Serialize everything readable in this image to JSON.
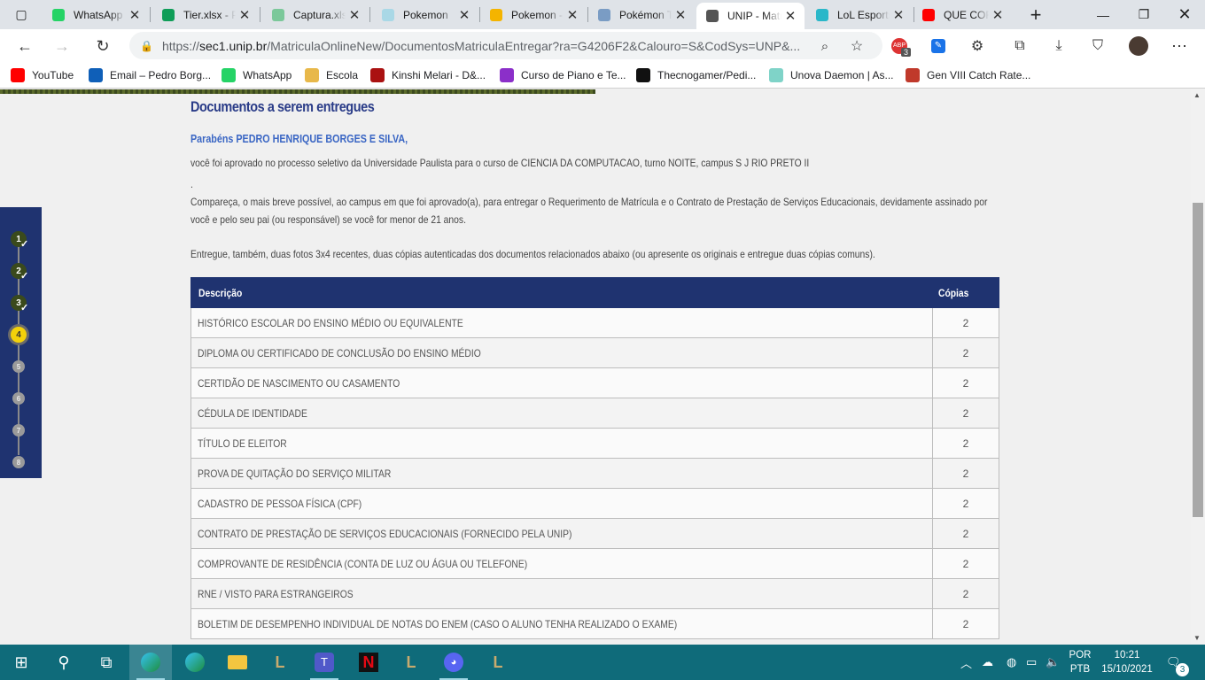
{
  "browser": {
    "tabs": [
      {
        "label": "WhatsApp",
        "icon": "whatsapp-icon",
        "color": "#25d366"
      },
      {
        "label": "Tier.xlsx - Planilhas Google",
        "icon": "sheets-icon",
        "color": "#0f9d58"
      },
      {
        "label": "Captura.xlsx - Planilhas Google",
        "icon": "sheets-icon",
        "color": "#7bc89a"
      },
      {
        "label": "Pokemon",
        "icon": "diamond-icon",
        "color": "#a9d8e6"
      },
      {
        "label": "Pokemon - Google Drive",
        "icon": "drive-icon",
        "color": "#f4b400"
      },
      {
        "label": "Pokémon Tier",
        "icon": "drop-icon",
        "color": "#7a9cc4"
      },
      {
        "label": "UNIP - Matrícula",
        "icon": "page-icon",
        "color": "#555555"
      },
      {
        "label": "LoL Esports",
        "icon": "lol-esports-icon",
        "color": "#2ab7c9"
      },
      {
        "label": "QUE COR É",
        "icon": "youtube-icon",
        "color": "#ff0000"
      }
    ],
    "new_tab": "+",
    "address": {
      "prefix": "https://",
      "host": "sec1.unip.br",
      "path": "/MatriculaOnlineNew/DocumentosMatriculaEntregar?ra=G4206F2&Calouro=S&CodSys=UNP&..."
    },
    "extension_badge": "3",
    "bookmarks": [
      {
        "label": "YouTube",
        "icon": "youtube-icon",
        "color": "#ff0000"
      },
      {
        "label": "Email – Pedro Borg...",
        "icon": "outlook-icon",
        "color": "#0f5fb8"
      },
      {
        "label": "WhatsApp",
        "icon": "whatsapp-icon",
        "color": "#25d366"
      },
      {
        "label": "Escola",
        "icon": "folder-icon",
        "color": "#e8b84a"
      },
      {
        "label": "Kinshi Melari - D&...",
        "icon": "dnd-icon",
        "color": "#a11"
      },
      {
        "label": "Curso de Piano e Te...",
        "icon": "piano-course-icon",
        "color": "#8b2fc9"
      },
      {
        "label": "Thecnogamer/Pedi...",
        "icon": "github-icon",
        "color": "#111111"
      },
      {
        "label": "Unova Daemon | As...",
        "icon": "gem-icon",
        "color": "#7fd3c8"
      },
      {
        "label": "Gen VIII Catch Rate...",
        "icon": "pokeball-icon",
        "color": "#c0392b"
      }
    ]
  },
  "page": {
    "title": "Documentos a serem entregues",
    "congrats": "Parabéns PEDRO HENRIQUE BORGES E SILVA,",
    "approved_text": "você foi aprovado no processo seletivo da Universidade Paulista para o curso de CIENCIA DA COMPUTACAO, turno NOITE, campus S J RIO PRETO II",
    "dot": ".",
    "instructions": "Compareça, o mais breve possível, ao campus em que foi aprovado(a), para entregar o Requerimento de Matrícula e o Contrato de Prestação de Serviços Educacionais, devidamente assinado por você e pelo seu pai (ou responsável) se você for menor de 21 anos.",
    "photos_text": "Entregue, também, duas fotos 3x4 recentes, duas cópias autenticadas dos documentos relacionados abaixo (ou apresente os originais e entregue duas cópias comuns).",
    "table": {
      "headers": {
        "description": "Descrição",
        "copies": "Cópias"
      },
      "rows": [
        {
          "description": "HISTÓRICO ESCOLAR DO ENSINO MÉDIO OU EQUIVALENTE",
          "copies": "2"
        },
        {
          "description": "DIPLOMA OU CERTIFICADO DE CONCLUSÃO DO ENSINO MÉDIO",
          "copies": "2"
        },
        {
          "description": "CERTIDÃO DE NASCIMENTO OU CASAMENTO",
          "copies": "2"
        },
        {
          "description": "CÉDULA DE IDENTIDADE",
          "copies": "2"
        },
        {
          "description": "TÍTULO DE ELEITOR",
          "copies": "2"
        },
        {
          "description": "PROVA DE QUITAÇÃO DO SERVIÇO MILITAR",
          "copies": "2"
        },
        {
          "description": "CADASTRO DE PESSOA FÍSICA (CPF)",
          "copies": "2"
        },
        {
          "description": "CONTRATO DE PRESTAÇÃO DE SERVIÇOS EDUCACIONAIS (FORNECIDO PELA UNIP)",
          "copies": "2"
        },
        {
          "description": "COMPROVANTE DE RESIDÊNCIA (CONTA DE LUZ OU ÁGUA OU TELEFONE)",
          "copies": "2"
        },
        {
          "description": "RNE / VISTO PARA ESTRANGEIROS",
          "copies": "2"
        },
        {
          "description": "BOLETIM DE DESEMPENHO INDIVIDUAL DE NOTAS DO ENEM (CASO O ALUNO TENHA REALIZADO O EXAME)",
          "copies": "2"
        }
      ]
    },
    "steps": [
      {
        "number": "1",
        "state": "done"
      },
      {
        "number": "2",
        "state": "done"
      },
      {
        "number": "3",
        "state": "done"
      },
      {
        "number": "4",
        "state": "current"
      },
      {
        "number": "5",
        "state": "todo"
      },
      {
        "number": "6",
        "state": "todo"
      },
      {
        "number": "7",
        "state": "todo"
      },
      {
        "number": "8",
        "state": "todo"
      }
    ]
  },
  "taskbar": {
    "language": "POR",
    "layout": "PTB",
    "time": "10:21",
    "date": "15/10/2021",
    "notifications": "3"
  }
}
